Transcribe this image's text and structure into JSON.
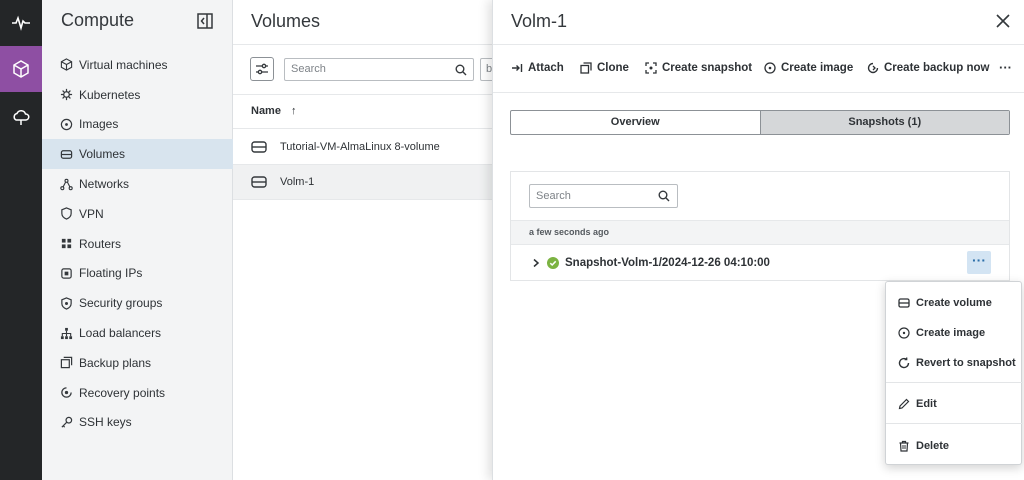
{
  "rail": {
    "items": [
      {
        "icon": "activity-icon",
        "active": false
      },
      {
        "icon": "cube-icon",
        "active": true
      },
      {
        "icon": "cloud-icon",
        "active": false
      }
    ]
  },
  "sidebar": {
    "title": "Compute",
    "items": [
      {
        "label": "Virtual machines",
        "icon": "cube-icon"
      },
      {
        "label": "Kubernetes",
        "icon": "kubernetes-icon"
      },
      {
        "label": "Images",
        "icon": "disc-icon"
      },
      {
        "label": "Volumes",
        "icon": "drive-icon",
        "active": true
      },
      {
        "label": "Networks",
        "icon": "network-icon"
      },
      {
        "label": "VPN",
        "icon": "shield-icon"
      },
      {
        "label": "Routers",
        "icon": "router-icon"
      },
      {
        "label": "Floating IPs",
        "icon": "floating-ip-icon"
      },
      {
        "label": "Security groups",
        "icon": "shield-gear-icon"
      },
      {
        "label": "Load balancers",
        "icon": "load-balancer-icon"
      },
      {
        "label": "Backup plans",
        "icon": "backup-icon"
      },
      {
        "label": "Recovery points",
        "icon": "recovery-icon"
      },
      {
        "label": "SSH keys",
        "icon": "key-icon"
      }
    ]
  },
  "list": {
    "title": "Volumes",
    "search_placeholder": "Search",
    "stub_text": "b",
    "column_name": "Name",
    "sort_arrow": "↑",
    "rows": [
      {
        "name": "Tutorial-VM-AlmaLinux 8-volume"
      },
      {
        "name": "Volm-1"
      }
    ]
  },
  "panel": {
    "title": "Volm-1",
    "actions": [
      {
        "label": "Attach",
        "icon": "attach-icon"
      },
      {
        "label": "Clone",
        "icon": "clone-icon"
      },
      {
        "label": "Create snapshot",
        "icon": "snapshot-icon"
      },
      {
        "label": "Create image",
        "icon": "image-icon"
      },
      {
        "label": "Create backup now",
        "icon": "backup-now-icon"
      }
    ],
    "more": "···",
    "tabs": [
      {
        "label": "Overview",
        "active": false
      },
      {
        "label": "Snapshots (1)",
        "active": true
      }
    ],
    "snap_search_placeholder": "Search",
    "group_label": "a few seconds ago",
    "snapshot_name": "Snapshot-Volm-1/2024-12-26 04:10:00",
    "snapshot_more": "···",
    "status_color": "#7cb342"
  },
  "menu": {
    "items": [
      {
        "label": "Create volume",
        "icon": "drive-icon"
      },
      {
        "label": "Create image",
        "icon": "disc-icon"
      },
      {
        "label": "Revert to snapshot",
        "icon": "revert-icon"
      },
      {
        "label": "Edit",
        "icon": "pencil-icon"
      },
      {
        "label": "Delete",
        "icon": "trash-icon"
      }
    ]
  },
  "colors": {
    "rail_bg": "#242628",
    "rail_active": "#8e4fa3",
    "sidebar_bg": "#f3f4f5",
    "active_item": "#d8e4ee",
    "more_btn_bg": "#d3e4f3"
  }
}
